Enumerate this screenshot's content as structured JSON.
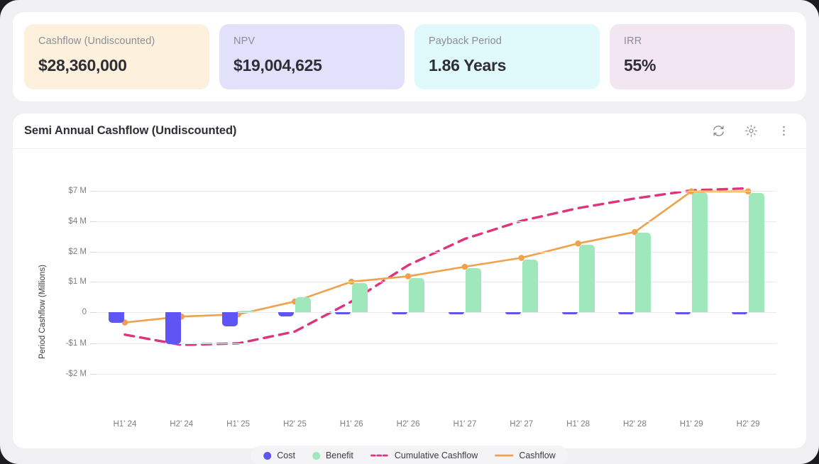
{
  "kpis": [
    {
      "label": "Cashflow (Undiscounted)",
      "value": "$28,360,000",
      "bg": "#fdf1de",
      "name": "cashflow-undiscounted"
    },
    {
      "label": "NPV",
      "value": "$19,004,625",
      "bg": "#e2e1fb",
      "name": "npv"
    },
    {
      "label": "Payback Period",
      "value": "1.86 Years",
      "bg": "#e0fafb",
      "name": "payback-period"
    },
    {
      "label": "IRR",
      "value": "55%",
      "bg": "#f2e6f2",
      "name": "irr"
    }
  ],
  "chart_panel": {
    "title": "Semi Annual Cashflow (Undiscounted)",
    "icons": [
      {
        "name": "refresh-icon",
        "label": "Refresh"
      },
      {
        "name": "gear-icon",
        "label": "Settings"
      },
      {
        "name": "more-vertical-icon",
        "label": "More options"
      }
    ]
  },
  "chart_data": {
    "type": "bar",
    "title": "Semi Annual Cashflow (Undiscounted)",
    "xlabel": "",
    "ylabel": "Period Cashflow (Millions)",
    "grid": true,
    "legend_position": "bottom",
    "categories": [
      "H1' 24",
      "H2' 24",
      "H1' 25",
      "H2' 25",
      "H1' 26",
      "H2' 26",
      "H1' 27",
      "H2' 27",
      "H1' 28",
      "H2' 28",
      "H1' 29",
      "H2' 29"
    ],
    "ytick_labels": [
      "$7 M",
      "$4 M",
      "$2 M",
      "$1 M",
      "0",
      "-$1 M",
      "-$2 M"
    ],
    "ytick_values": [
      7,
      4,
      2,
      1,
      0,
      -1,
      -2
    ],
    "ylim": [
      -2,
      7
    ],
    "series": [
      {
        "name": "Cost",
        "type": "bar",
        "color": "#5f55f4",
        "values": [
          -0.33,
          -1.02,
          -0.45,
          -0.13,
          -0.07,
          -0.06,
          -0.06,
          -0.06,
          -0.05,
          -0.05,
          -0.02,
          -0.02
        ]
      },
      {
        "name": "Benefit",
        "type": "bar",
        "color": "#9fe8bb",
        "values": [
          0,
          0,
          0.05,
          0.48,
          0.95,
          1.12,
          1.45,
          1.75,
          2.45,
          3.25,
          6.85,
          6.8
        ]
      },
      {
        "name": "Cashflow",
        "type": "line",
        "color": "#efa24b",
        "style": "solid",
        "values": [
          -0.33,
          -0.14,
          -0.07,
          0.35,
          1.0,
          1.18,
          1.5,
          1.8,
          2.55,
          3.3,
          6.95,
          6.95
        ]
      },
      {
        "name": "Cumulative Cashflow",
        "type": "line",
        "color": "#e0337d",
        "style": "dashed",
        "values": [
          -0.72,
          -1.05,
          -1.0,
          -0.62,
          0.35,
          1.55,
          2.85,
          4.05,
          5.3,
          6.25,
          7.05,
          7.25
        ]
      }
    ],
    "legend": [
      "Cost",
      "Benefit",
      "Cumulative Cashflow",
      "Cashflow"
    ]
  }
}
